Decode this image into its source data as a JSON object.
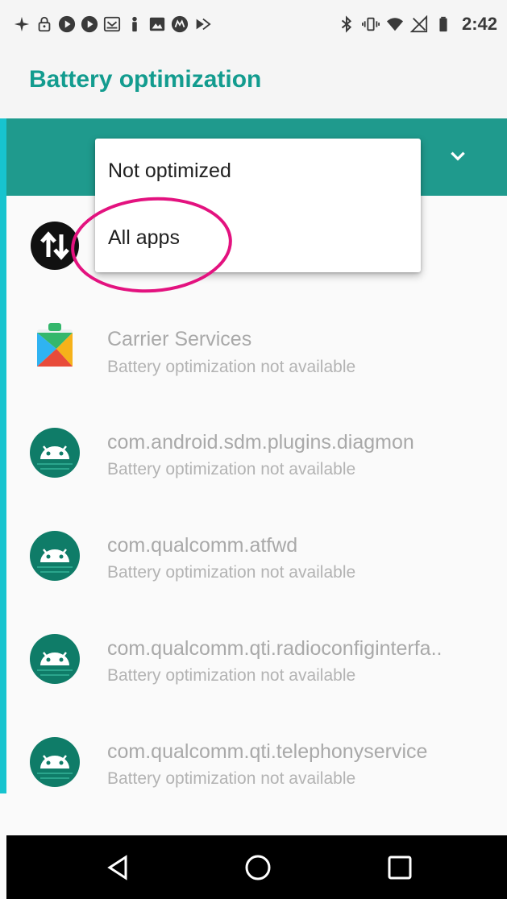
{
  "status_bar": {
    "time": "2:42",
    "left_icons": [
      "sparkle-icon",
      "lock-icon",
      "play-circle-icon",
      "play-circle-icon",
      "mail-icon",
      "figure-icon",
      "image-icon",
      "motorola-icon",
      "forward-icon"
    ],
    "right_icons": [
      "bluetooth-icon",
      "vibrate-icon",
      "wifi-icon",
      "no-signal-icon",
      "battery-icon"
    ]
  },
  "app_bar": {
    "title": "Battery optimization"
  },
  "filter": {
    "selected": "All apps",
    "icon": "chevron-down-icon"
  },
  "dropdown": {
    "options": [
      {
        "label": "Not optimized"
      },
      {
        "label": "All apps"
      }
    ]
  },
  "apps": [
    {
      "name": "",
      "status": "",
      "icon": "data-transfer-icon"
    },
    {
      "name": "Carrier Services",
      "status": "Battery optimization not available",
      "icon": "carrier-services-icon"
    },
    {
      "name": "com.android.sdm.plugins.diagmon",
      "status": "Battery optimization not available",
      "icon": "android-icon"
    },
    {
      "name": "com.qualcomm.atfwd",
      "status": "Battery optimization not available",
      "icon": "android-icon"
    },
    {
      "name": "com.qualcomm.qti.radioconfiginterfa..",
      "status": "Battery optimization not available",
      "icon": "android-icon"
    },
    {
      "name": "com.qualcomm.qti.telephonyservice",
      "status": "Battery optimization not available",
      "icon": "android-icon"
    }
  ],
  "nav_bar": {
    "buttons": [
      "back-icon",
      "home-icon",
      "recents-icon"
    ]
  },
  "colors": {
    "accent": "#139c8f",
    "filter_bar": "#1f9a8d",
    "highlight_ring": "#e3127f",
    "left_strip": "#17c4cf"
  }
}
